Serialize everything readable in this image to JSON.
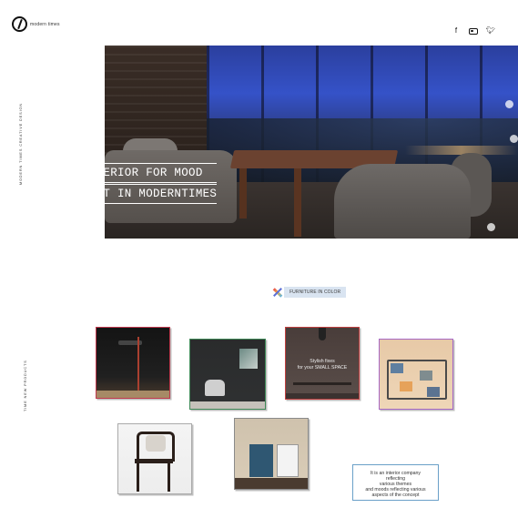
{
  "header": {
    "logo_text": "modern times",
    "social": [
      "facebook-icon",
      "instagram-icon",
      "twitter-icon"
    ]
  },
  "side": {
    "top_text": "MODERN TIMES CREATIVE DESIGN",
    "bottom_text": "TIME NEW PRODUCTS"
  },
  "hero": {
    "line1": "INTERIOR FOR MOOD",
    "line2": "NEST IN MODERNTIMES"
  },
  "section": {
    "label": "FURNITURE IN COLOR",
    "icon": "pencil-icon"
  },
  "tiles": [
    {
      "name": "product-floor-lamp"
    },
    {
      "name": "product-chair-dark-room"
    },
    {
      "name": "product-small-space",
      "text_line1": "Stylish fixes",
      "text_line2": "for your SMALL SPACE"
    },
    {
      "name": "product-color-boxes"
    },
    {
      "name": "product-wooden-chair"
    },
    {
      "name": "product-cabinets"
    }
  ],
  "info": {
    "line1": "It is an interior company",
    "line2": "reflecting",
    "line3": "various themes",
    "line4": "and moods reflecting various",
    "line5": "aspects of the concept"
  },
  "colors": {
    "tile1_border": "#c0394d",
    "tile2_border": "#3f8a58",
    "tile3_border": "#c04040",
    "tile4_border": "#a868c6",
    "info_border": "#6aa0c8",
    "chip_bg": "#d9e4f1"
  }
}
